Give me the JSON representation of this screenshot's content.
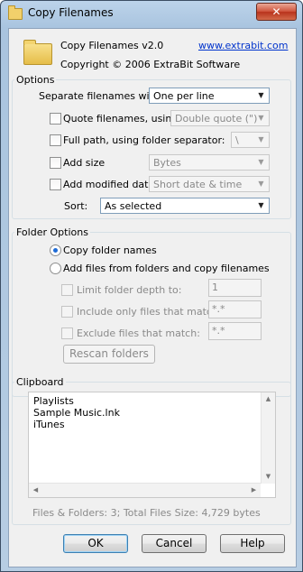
{
  "window": {
    "title": "Copy Filenames",
    "close_glyph": "✕"
  },
  "header": {
    "app_name": "Copy Filenames v2.0",
    "link": "www.extrabit.com",
    "copyright": "Copyright © 2006 ExtraBit Software"
  },
  "options": {
    "legend": "Options",
    "separate_label": "Separate filenames with:",
    "separate_value": "One per line",
    "quote_label": "Quote filenames, using:",
    "quote_value": "Double quote (\")",
    "fullpath_label": "Full path, using folder separator:",
    "fullpath_value": "\\",
    "addsize_label": "Add size",
    "addsize_value": "Bytes",
    "moddate_label": "Add modified date",
    "moddate_value": "Short date & time",
    "sort_label": "Sort:",
    "sort_value": "As selected"
  },
  "folder_options": {
    "legend": "Folder Options",
    "radio1": "Copy folder names",
    "radio2": "Add files from folders and copy filenames",
    "depth_label": "Limit folder depth to:",
    "depth_value": "1",
    "include_label": "Include only files that match:",
    "include_value": "*.*",
    "exclude_label": "Exclude files that match:",
    "exclude_value": "*.*",
    "rescan_label": "Rescan folders"
  },
  "clipboard": {
    "legend": "Clipboard",
    "items": [
      "Playlists",
      "Sample Music.lnk",
      "iTunes"
    ],
    "status": "Files & Folders: 3;  Total Files Size: 4,729 bytes"
  },
  "buttons": {
    "ok": "OK",
    "cancel": "Cancel",
    "help": "Help"
  },
  "icons": {
    "app": "folder-icon",
    "dropdown": "chevron-down-icon"
  },
  "colors": {
    "accent": "#1e6bd6",
    "link": "#0033cc",
    "close": "#c7442c"
  }
}
